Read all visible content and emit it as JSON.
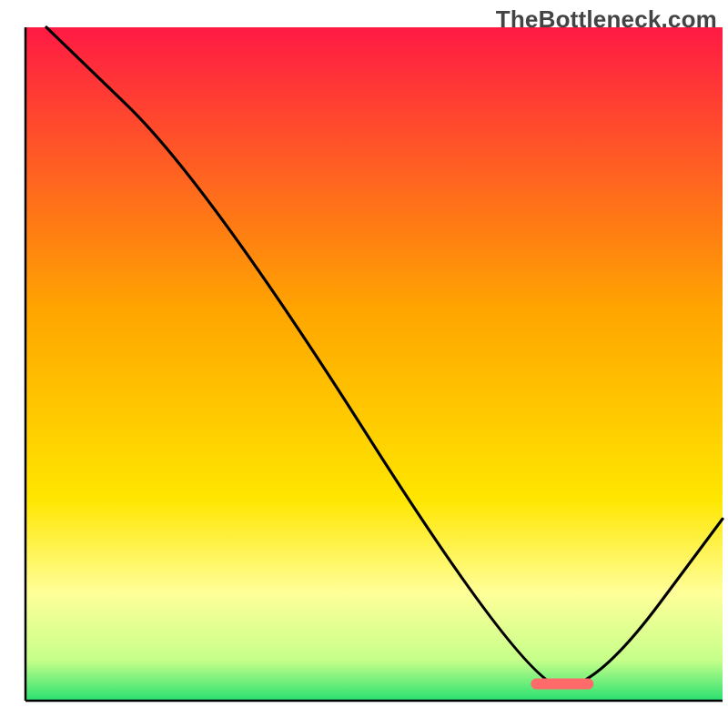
{
  "meta": {
    "watermark": "TheBottleneck.com"
  },
  "chart_data": {
    "type": "line",
    "title": "",
    "xlabel": "",
    "ylabel": "",
    "xlim": [
      0,
      100
    ],
    "ylim": [
      0,
      100
    ],
    "legend": false,
    "grid": false,
    "background_gradient": {
      "stops": [
        {
          "offset": 0.0,
          "color": "#ff1a44"
        },
        {
          "offset": 0.42,
          "color": "#ffa500"
        },
        {
          "offset": 0.7,
          "color": "#ffe600"
        },
        {
          "offset": 0.84,
          "color": "#ffff99"
        },
        {
          "offset": 0.94,
          "color": "#c6ff8a"
        },
        {
          "offset": 1.0,
          "color": "#28e070"
        }
      ]
    },
    "x": [
      3,
      26,
      72,
      82,
      100
    ],
    "series": [
      {
        "name": "bottleneck-curve",
        "values": [
          100,
          77,
          2,
          2,
          27
        ]
      }
    ],
    "marker": {
      "name": "highlight-bar",
      "x_center": 77,
      "y": 2.5,
      "width": 9,
      "color": "#ff6b6b"
    }
  }
}
